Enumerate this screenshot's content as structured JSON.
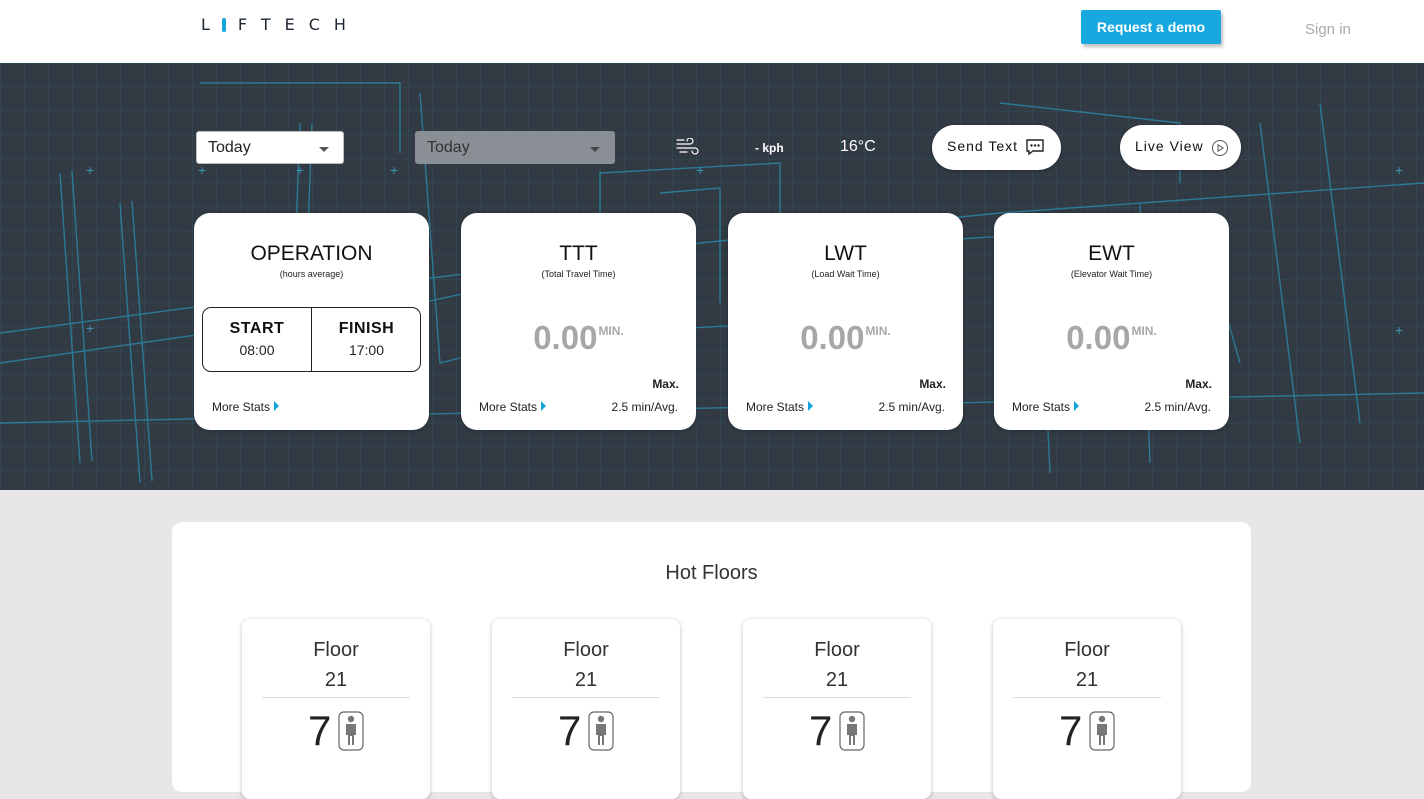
{
  "header": {
    "logo_text": "LIFTECH",
    "demo_label": "Request a demo",
    "signin_label": "Sign in",
    "accent_color": "#18a8e0"
  },
  "toolbar": {
    "range_select_1": "Today",
    "range_select_2": "Today",
    "wind_icon": "wind-icon",
    "wind_speed": "- kph",
    "temperature": "16°C",
    "send_text_label": "Send Text",
    "live_view_label": "Live View"
  },
  "cards": {
    "operation": {
      "title": "OPERATION",
      "subtitle": "(hours average)",
      "start_label": "START",
      "start_value": "08:00",
      "finish_label": "FINISH",
      "finish_value": "17:00",
      "more": "More Stats"
    },
    "ttt": {
      "title": "TTT",
      "subtitle": "(Total Travel Time)",
      "value": "0.00",
      "unit": "MIN.",
      "max_label": "Max.",
      "avg": "2.5 min/Avg.",
      "more": "More Stats"
    },
    "lwt": {
      "title": "LWT",
      "subtitle": "(Load Wait Time)",
      "value": "0.00",
      "unit": "MIN.",
      "max_label": "Max.",
      "avg": "2.5 min/Avg.",
      "more": "More Stats"
    },
    "ewt": {
      "title": "EWT",
      "subtitle": "(Elevator Wait Time)",
      "value": "0.00",
      "unit": "MIN.",
      "max_label": "Max.",
      "avg": "2.5 min/Avg.",
      "more": "More Stats"
    }
  },
  "hot_floors": {
    "title": "Hot Floors",
    "floors": [
      {
        "label": "Floor",
        "number": "21",
        "count": "7"
      },
      {
        "label": "Floor",
        "number": "21",
        "count": "7"
      },
      {
        "label": "Floor",
        "number": "21",
        "count": "7"
      },
      {
        "label": "Floor",
        "number": "21",
        "count": "7"
      }
    ]
  }
}
